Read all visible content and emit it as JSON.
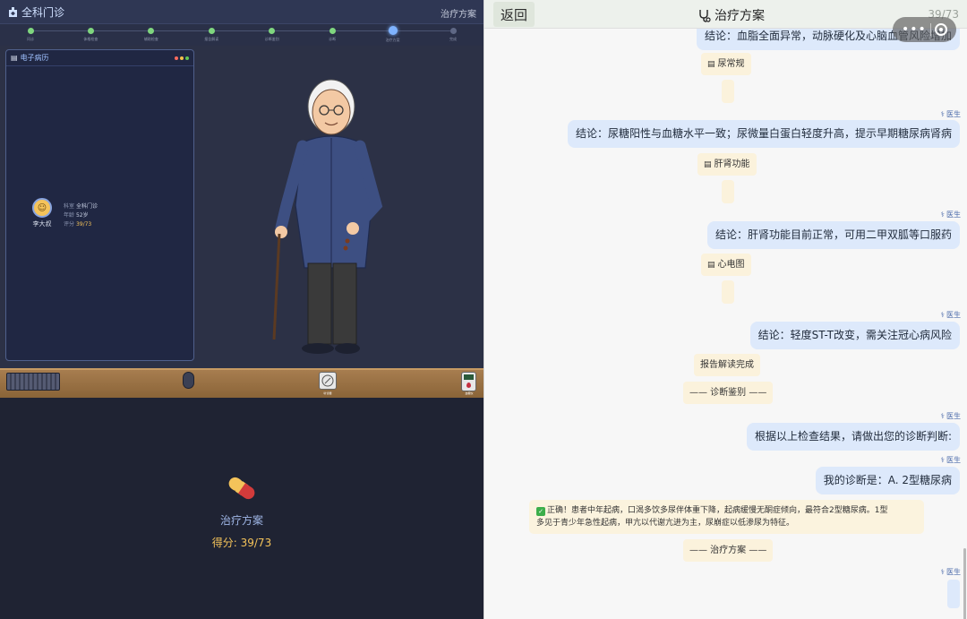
{
  "left": {
    "app_title": "全科门诊",
    "current_stage": "治疗方案",
    "steps": [
      {
        "label": "问诊",
        "state": "done"
      },
      {
        "label": "体格检查",
        "state": "done"
      },
      {
        "label": "辅助检查",
        "state": "done"
      },
      {
        "label": "报告解读",
        "state": "done"
      },
      {
        "label": "诊断鉴别",
        "state": "done"
      },
      {
        "label": "诊断",
        "state": "done"
      },
      {
        "label": "治疗方案",
        "state": "current"
      },
      {
        "label": "完成",
        "state": "todo"
      }
    ],
    "emr": {
      "title": "电子病历",
      "patient_name": "李大叔",
      "dept_label": "科室",
      "dept_value": "全科门诊",
      "age_label": "年龄",
      "age_value": "52岁",
      "score_label": "评分",
      "score_value": "39/73"
    },
    "desk": {
      "compass_label": "听诊器",
      "bp_label": "血糖仪"
    },
    "stage_card": {
      "name": "治疗方案",
      "score": "得分: 39/73"
    }
  },
  "right": {
    "back_label": "返回",
    "title": "治疗方案",
    "score": "39/73",
    "doctor_label": "医生",
    "messages": {
      "m1": "结论：血脂全面异常，动脉硬化及心脑血管风险增加",
      "t1": "尿常规",
      "m2": "结论：尿糖阳性与血糖水平一致；尿微量白蛋白轻度升高，提示早期糖尿病肾病",
      "t2": "肝肾功能",
      "m3": "结论：肝肾功能目前正常，可用二甲双胍等口服药",
      "t3": "心电图",
      "m4": "结论：轻度ST-T改变，需关注冠心病风险",
      "t4": "报告解读完成",
      "t5": "—— 诊断鉴别 ——",
      "m5": "根据以上检查结果，请做出您的诊断判断:",
      "m6": "我的诊断是：A. 2型糖尿病",
      "answer_line1": "正确！患者中年起病，口渴多饮多尿伴体重下降，起病缓慢无酮症倾向，最符合2型糖尿病。1型",
      "answer_line2": "多见于青少年急性起病，甲亢以代谢亢进为主，尿崩症以低渗尿为特征。",
      "t6": "—— 治疗方案 ——"
    }
  },
  "colors": {
    "accent_blue": "#7fb3ff",
    "done_green": "#7fd67f",
    "score_gold": "#f4c35a",
    "bubble_blue": "#dde9fb",
    "tag_cream": "#fbf2dc"
  }
}
